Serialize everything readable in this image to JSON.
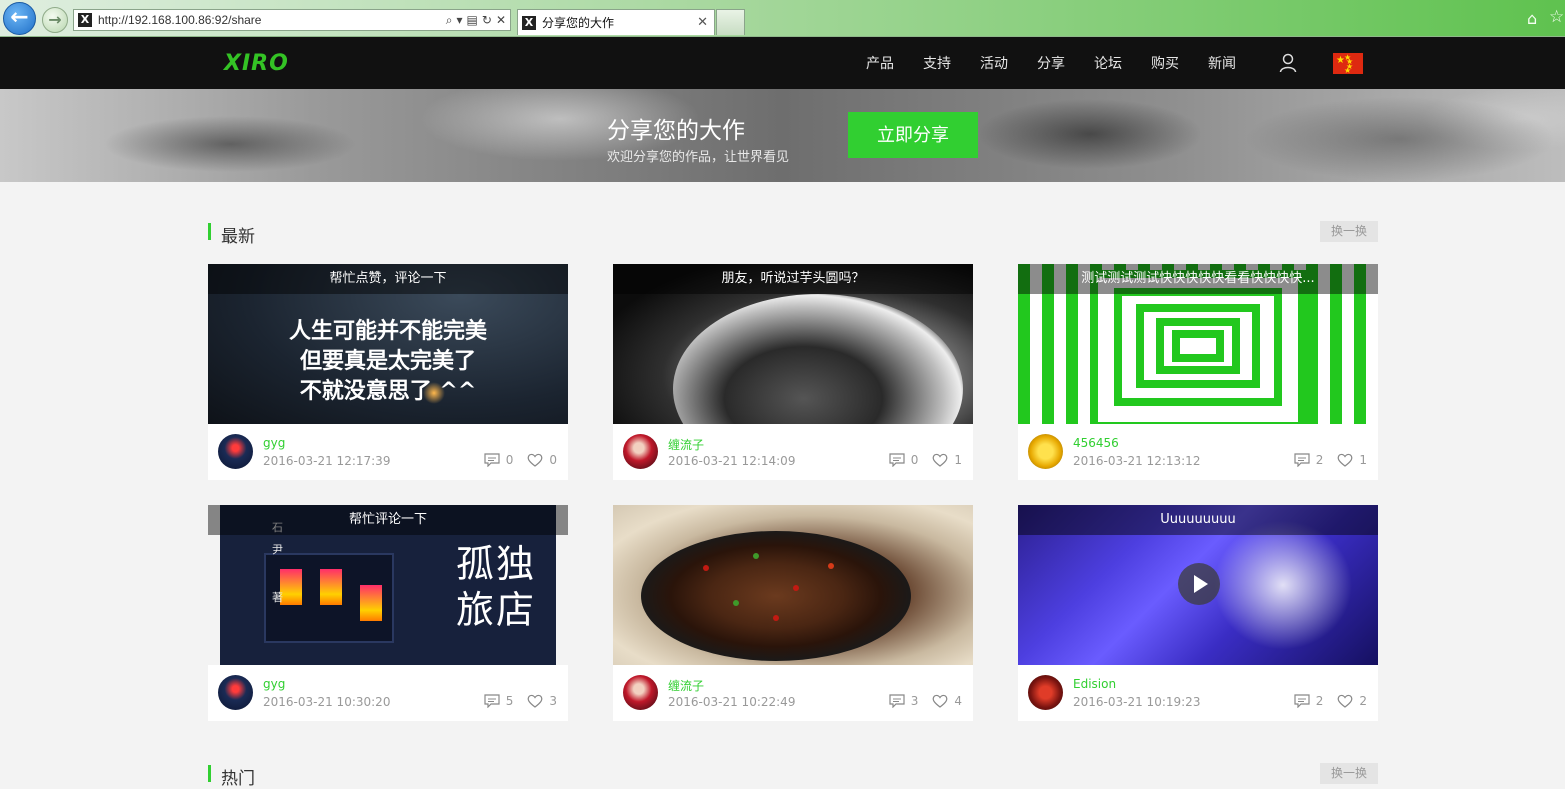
{
  "browser": {
    "url": "http://192.168.100.86:92/share",
    "tab_title": "分享您的大作"
  },
  "site": {
    "logo": "XIRO",
    "nav": [
      "产品",
      "支持",
      "活动",
      "分享",
      "论坛",
      "购买",
      "新闻"
    ]
  },
  "banner": {
    "title": "分享您的大作",
    "subtitle": "欢迎分享您的作品，让世界看见",
    "button": "立即分享"
  },
  "sections": [
    {
      "title": "最新",
      "swap_label": "换一换"
    },
    {
      "title": "热门",
      "swap_label": "换一换"
    }
  ],
  "cards": [
    {
      "caption": "帮忙点赞，评论一下",
      "author": "gyg",
      "date": "2016-03-21 12:17:39",
      "comments": "0",
      "likes": "0",
      "image_text": [
        "人生可能并不能完美",
        "但要真是太完美了",
        "不就没意思了 ^^"
      ]
    },
    {
      "caption": "朋友，听说过芋头圆吗？",
      "author": "缠流子",
      "date": "2016-03-21 12:14:09",
      "comments": "0",
      "likes": "1"
    },
    {
      "caption": "测试测试测试快快快快快看看快快快快...",
      "author": "456456",
      "date": "2016-03-21 12:13:12",
      "comments": "2",
      "likes": "1"
    },
    {
      "caption": "帮忙评论一下",
      "author": "gyg",
      "date": "2016-03-21 10:30:20",
      "comments": "5",
      "likes": "3",
      "image_text": [
        "孤独",
        "旅店",
        "石",
        "尹",
        "著"
      ]
    },
    {
      "caption": "",
      "author": "缠流子",
      "date": "2016-03-21 10:22:49",
      "comments": "3",
      "likes": "4"
    },
    {
      "caption": "Uuuuuuuuu",
      "author": "Edision",
      "date": "2016-03-21 10:19:23",
      "comments": "2",
      "likes": "2"
    }
  ],
  "colors": {
    "accent": "#31cf31",
    "header_bg": "#111111",
    "page_bg": "#f3f3f3"
  }
}
